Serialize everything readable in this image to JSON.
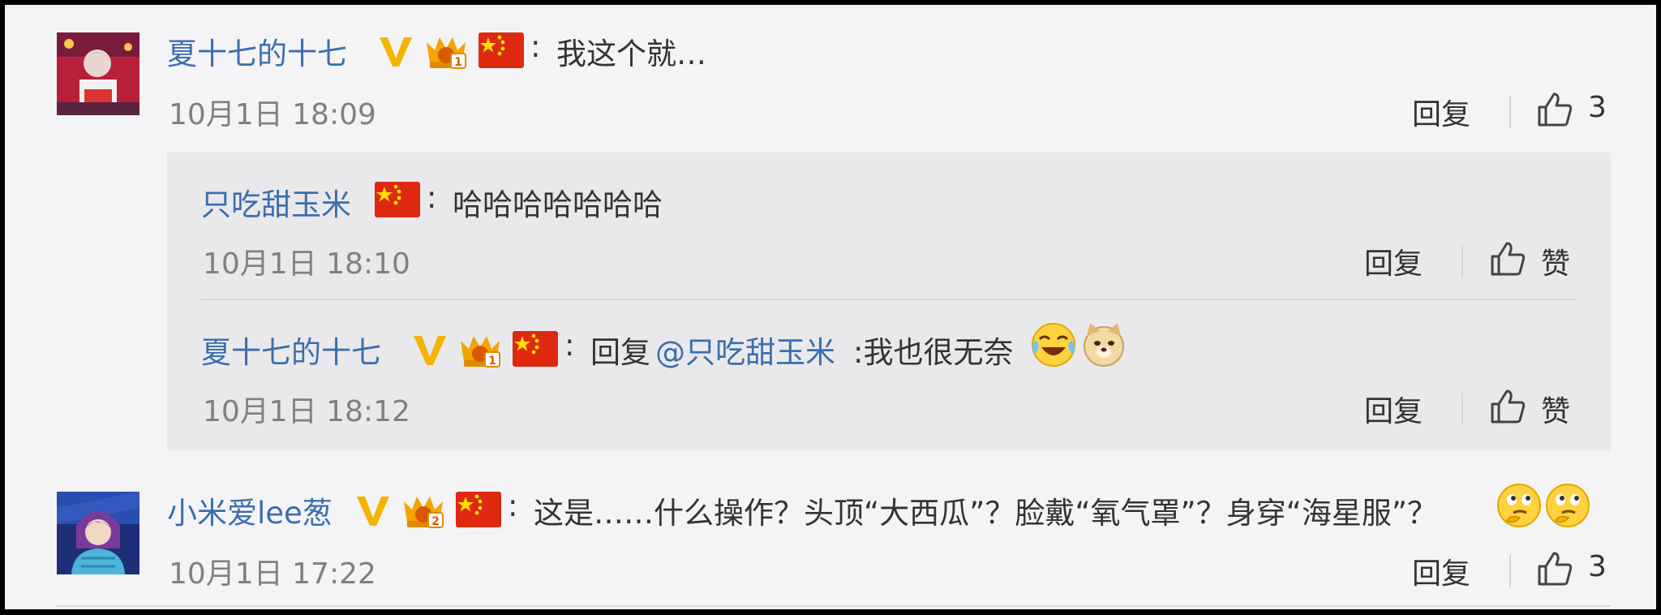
{
  "comments": [
    {
      "username": "夏十七的十七",
      "text": "我这个就…",
      "time": "10月1日 18:09",
      "reply_label": "回复",
      "like_count": "3",
      "replies": [
        {
          "username": "只吃甜玉米",
          "text": "哈哈哈哈哈哈哈",
          "time": "10月1日 18:10",
          "reply_label": "回复",
          "like_label": "赞"
        },
        {
          "username": "夏十七的十七",
          "text_prefix": "回复",
          "mention": "@只吃甜玉米",
          "text": ":我也很无奈",
          "time": "10月1日 18:12",
          "reply_label": "回复",
          "like_label": "赞"
        }
      ]
    },
    {
      "username": "小米爱lee葱",
      "text": "这是……什么操作？头顶“大西瓜”？脸戴“氧气罩”？身穿“海星服”？",
      "time": "10月1日 17:22",
      "reply_label": "回复",
      "like_count": "3"
    }
  ],
  "colors": {
    "link": "#3b6eae",
    "background": "#f4f4f6",
    "reply_box": "#e9e9ec",
    "verified_badge": "#f5b400"
  },
  "icons": [
    "verified-v-icon",
    "crown-badge-icon",
    "china-flag-icon",
    "thumb-up-icon",
    "laugh-cry-emoji",
    "doge-emoji",
    "thinking-emoji"
  ]
}
